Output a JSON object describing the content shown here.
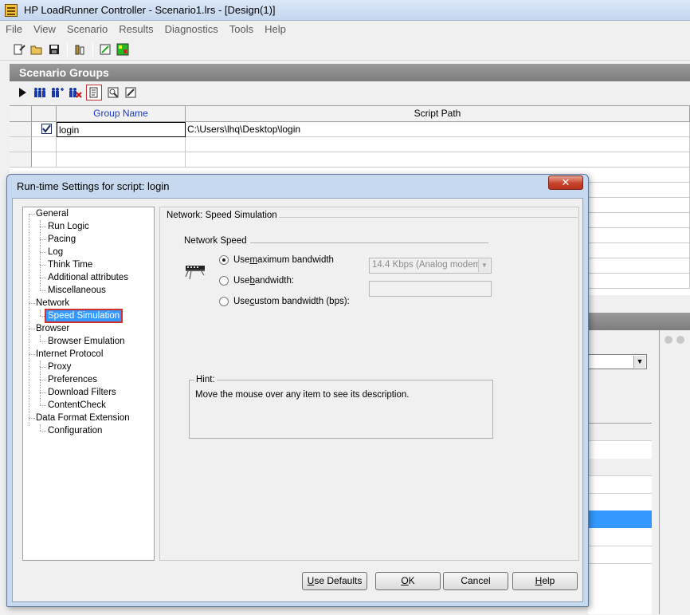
{
  "window": {
    "title": "HP LoadRunner Controller - Scenario1.lrs - [Design(1)]"
  },
  "menu": [
    "File",
    "View",
    "Scenario",
    "Results",
    "Diagnostics",
    "Tools",
    "Help"
  ],
  "toolbar": {
    "icons": [
      "new-scenario-icon",
      "open-icon",
      "save-icon",
      "vusers-icon",
      "analyze-icon",
      "chart-icon"
    ]
  },
  "scenario_groups": {
    "header": "Scenario Groups",
    "toolbar_icons": [
      "play-icon",
      "vusers-icon",
      "add-vusers-icon",
      "remove-vusers-icon",
      "runtime-settings-icon",
      "details-icon",
      "edit-script-icon"
    ],
    "columns": [
      "Group Name",
      "Script Path"
    ],
    "rows": [
      {
        "checked": true,
        "group_name": "login",
        "script_path": "C:\\Users\\lhq\\Desktop\\login"
      }
    ]
  },
  "dialog": {
    "title": "Run-time Settings for script: login",
    "close_glyph": "✕",
    "tree": [
      {
        "label": "General",
        "level": 0
      },
      {
        "label": "Run Logic",
        "level": 1
      },
      {
        "label": "Pacing",
        "level": 1
      },
      {
        "label": "Log",
        "level": 1
      },
      {
        "label": "Think Time",
        "level": 1
      },
      {
        "label": "Additional attributes",
        "level": 1
      },
      {
        "label": "Miscellaneous",
        "level": 1
      },
      {
        "label": "Network",
        "level": 0
      },
      {
        "label": "Speed Simulation",
        "level": 1,
        "selected": true
      },
      {
        "label": "Browser",
        "level": 0
      },
      {
        "label": "Browser Emulation",
        "level": 1
      },
      {
        "label": "Internet Protocol",
        "level": 0
      },
      {
        "label": "Proxy",
        "level": 1
      },
      {
        "label": "Preferences",
        "level": 1
      },
      {
        "label": "Download Filters",
        "level": 1
      },
      {
        "label": "ContentCheck",
        "level": 1
      },
      {
        "label": "Data Format Extension",
        "level": 0
      },
      {
        "label": "Configuration",
        "level": 1
      }
    ],
    "panel_title": "Network: Speed Simulation",
    "network_speed": {
      "caption": "Network Speed",
      "options": [
        {
          "pre": "Use ",
          "u": "m",
          "post": "aximum bandwidth",
          "checked": true
        },
        {
          "pre": "Use ",
          "u": "b",
          "post": "andwidth:",
          "checked": false
        },
        {
          "pre": "Use ",
          "u": "c",
          "post": "ustom bandwidth (bps):",
          "checked": false
        }
      ],
      "bandwidth_value": "14.4 Kbps (Analog modem)",
      "custom_value": ""
    },
    "hint": {
      "caption": "Hint:",
      "text": "Move the mouse over any item to see its description."
    },
    "buttons": {
      "use_defaults": {
        "u": "U",
        "rest": "se Defaults"
      },
      "ok": {
        "u": "O",
        "rest": "K"
      },
      "cancel": "Cancel",
      "help": {
        "u": "H",
        "rest": "elp"
      }
    }
  }
}
